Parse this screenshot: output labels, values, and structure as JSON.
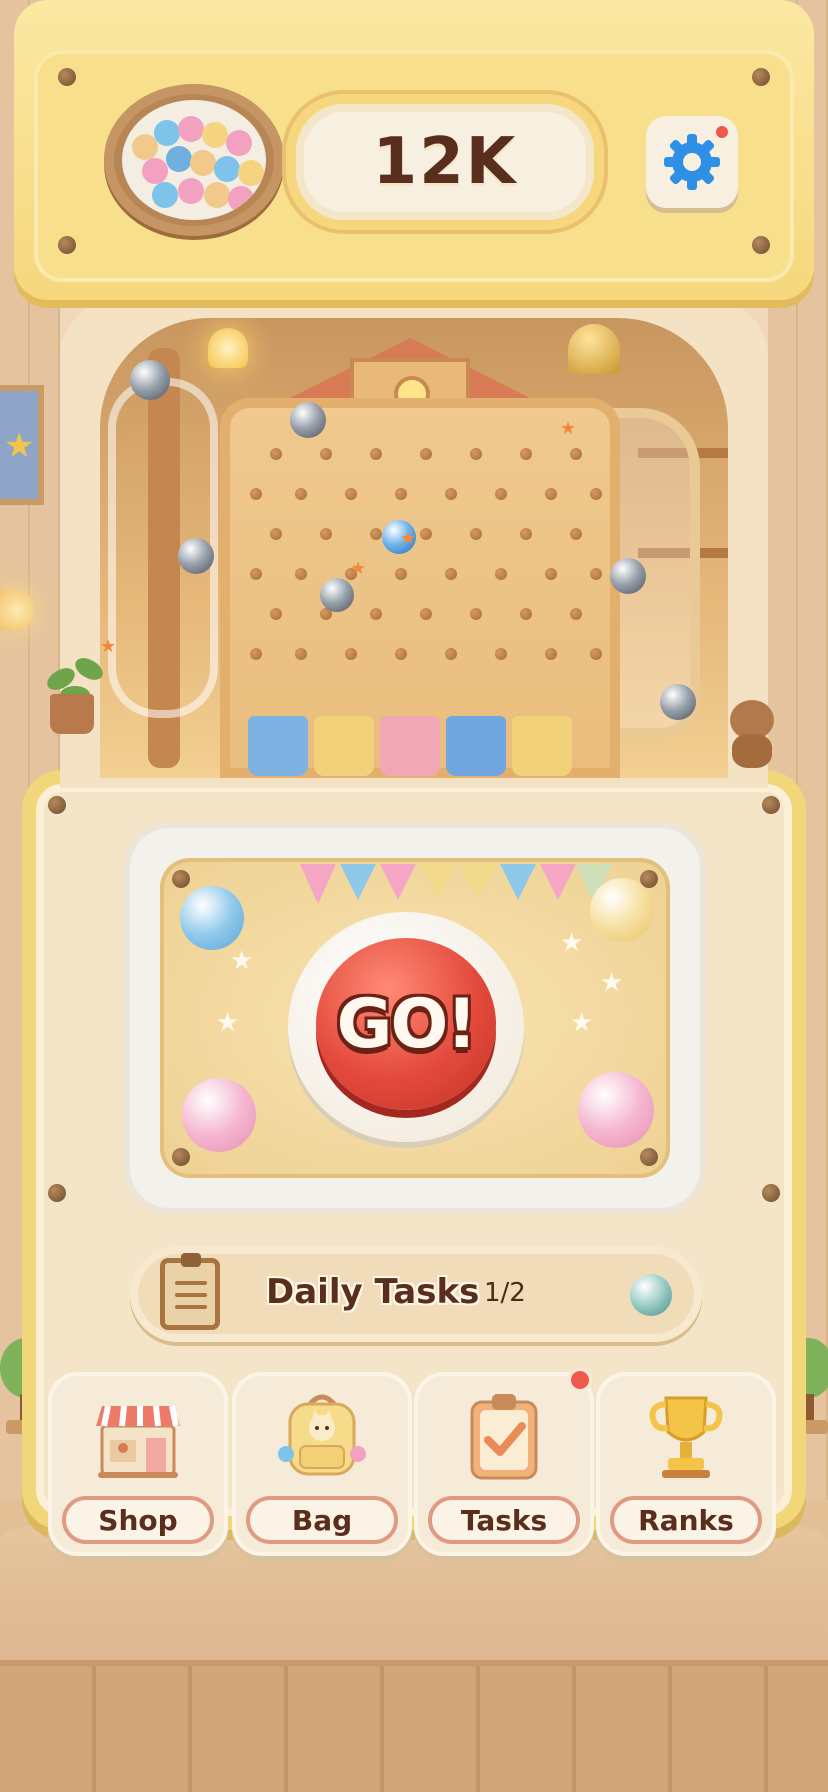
{
  "hud": {
    "coins": "12K",
    "settings_icon": "gear-icon",
    "settings_notification": true
  },
  "play_button": {
    "label": "GO!"
  },
  "daily_tasks": {
    "label": "Daily Tasks",
    "progress": "1/2",
    "icon": "clipboard-icon"
  },
  "nav": [
    {
      "label": "Shop",
      "icon": "shop-icon",
      "notification": false
    },
    {
      "label": "Bag",
      "icon": "backpack-icon",
      "notification": false
    },
    {
      "label": "Tasks",
      "icon": "clipboard-check-icon",
      "notification": true
    },
    {
      "label": "Ranks",
      "icon": "trophy-icon",
      "notification": false
    }
  ],
  "colors": {
    "machine_yellow": "#f6d77d",
    "go_red": "#e34a3c",
    "text_brown": "#5a2e1c",
    "settings_blue": "#2e8fe6",
    "notification_red": "#ee5a4b"
  }
}
